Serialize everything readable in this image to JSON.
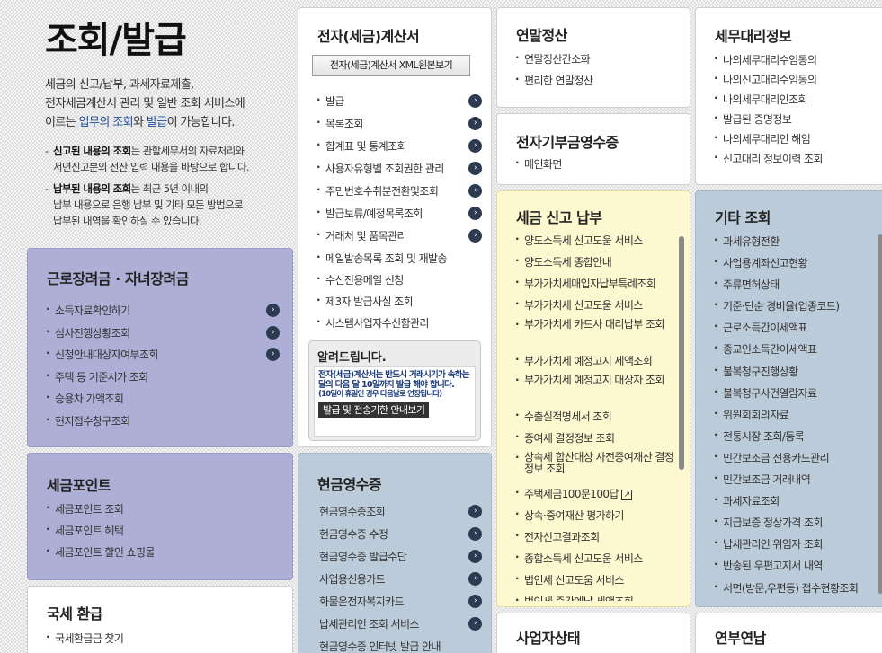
{
  "intro": {
    "title": "조회/발급",
    "desc_line1": "세금의 신고/납부, 과세자료제출,",
    "desc_line2": "전자세금계산서 관리 및 일반 조회 서비스에",
    "desc_line3_pre": "이르는 ",
    "desc_line3_hl1": "업무의 조회",
    "desc_line3_mid": "와 ",
    "desc_line3_hl2": "발급",
    "desc_line3_post": "이 가능합니다.",
    "note1_bold": "신고된 내용의 조회",
    "note1_rest": "는 관할세무서의 자료처리와",
    "note1_line2": "서면신고분의 전산 입력 내용을 바탕으로 합니다.",
    "note2_bold": "납부된 내용의 조회",
    "note2_rest": "는 최근 5년 이내의",
    "note2_line2": "납부 내용으로 은행 납부 및 기타 모든 방법으로",
    "note2_line3": "납부된 내역을 확인하실 수 있습니다."
  },
  "earned": {
    "title": "근로장려금 · 자녀장려금",
    "items": [
      "소득자료확인하기",
      "심사진행상황조회",
      "신청안내대상자여부조회",
      "주택 등 기준시가 조회",
      "승용차 가액조회",
      "현지접수창구조회"
    ]
  },
  "taxpoint": {
    "title": "세금포인트",
    "items": [
      "세금포인트 조회",
      "세금포인트 혜택",
      "세금포인트 할인 쇼핑몰"
    ]
  },
  "refund": {
    "title": "국세 환급",
    "items": [
      "국세환급금 찾기"
    ]
  },
  "einvoice": {
    "title": "전자(세금)계산서",
    "xml_button": "전자(세금)계산서 XML원본보기",
    "items": [
      "발급",
      "목록조회",
      "합계표 및 통계조회",
      "사용자유형별 조회권한 관리",
      "주민번호수취분전환및조회",
      "발급보류/예정목록조회",
      "거래처 및 품목관리",
      "메일발송목록 조회 및 재발송",
      "수신전용메일 신청",
      "제3자 발급사실 조회",
      "시스템사업자수신함관리"
    ],
    "notice_title": "알려드립니다.",
    "notice_text": "전자(세금)계산서는 반드시 거래시기가 속하는 달의 다음 달 10일까지 발급 해야 합니다.",
    "notice_sub": "(10일이 휴일인 경우 다음날로 연장됩니다)",
    "notice_button": "발급 및 전송기한 안내보기"
  },
  "cash": {
    "title": "현금영수증",
    "items": [
      "현금영수증조회",
      "현금영수증 수정",
      "현금영수증 발급수단",
      "사업용신용카드",
      "화물운전자복지카드",
      "납세관리인 조회 서비스",
      "현금영수증 인터넷 발급 안내"
    ]
  },
  "yearend": {
    "title": "연말정산",
    "items": [
      "연말정산간소화",
      "편리한 연말정산"
    ]
  },
  "donation": {
    "title": "전자기부금영수증",
    "items": [
      "메인화면"
    ]
  },
  "filing": {
    "title": "세금 신고 납부",
    "items": [
      "양도소득세 신고도움 서비스",
      "양도소득세 종합안내",
      "부가가치세매입자납부특례조회",
      "부가가치세 신고도움 서비스",
      "부가가치세 카드사 대리납부 조회",
      "부가가치세 예정고지 세액조회",
      "부가가치세 예정고지 대상자 조회",
      "수출실적명세서 조회",
      "증여세 결정정보 조회",
      "상속세 합산대상 사전증여재산 결정정보 조회",
      "주택세금100문100답",
      "상속·증여재산 평가하기",
      "전자신고결과조회",
      "종합소득세 신고도움 서비스",
      "법인세 신고도움 서비스",
      "법인세 중간예납 세액조회"
    ]
  },
  "business": {
    "title": "사업자상태"
  },
  "agent": {
    "title": "세무대리정보",
    "items": [
      "나의세무대리수임동의",
      "나의신고대리수임동의",
      "나의세무대리인조회",
      "발급된 증명정보",
      "나의세무대리인 해임",
      "신고대리 정보이력 조회"
    ]
  },
  "other": {
    "title": "기타 조회",
    "items": [
      "과세유형전환",
      "사업용계좌신고현황",
      "주류면허상태",
      "기준·단순 경비율(업종코드)",
      "근로소득간이세액표",
      "종교인소득간이세액표",
      "불복청구진행상황",
      "불복청구사건열람자료",
      "위원회회의자료",
      "전통시장 조회/등록",
      "민간보조금 전용카드관리",
      "민간보조금 거래내역",
      "과세자료조회",
      "지급보증 정상가격 조회",
      "납세관리인 위임자 조회",
      "반송된 우편고지서 내역",
      "서면(방문,우편등) 접수현황조회"
    ]
  },
  "annual": {
    "title": "연부연납"
  },
  "icons": {
    "arrow": "›",
    "external": "↗"
  }
}
